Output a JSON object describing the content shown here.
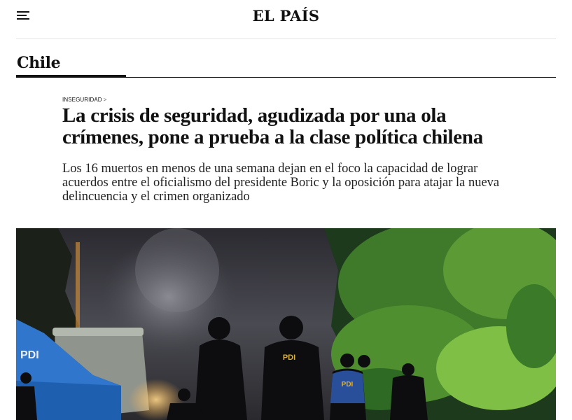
{
  "header": {
    "logo": "EL PAÍS",
    "menu_icon": "hamburger-menu-icon"
  },
  "section": {
    "title": "Chile"
  },
  "article": {
    "kicker": "Inseguridad",
    "kicker_separator": ">",
    "headline_line1": "La crisis de seguridad, agudizada por una ola",
    "headline_line2": "crímenes, pone a prueba a la clase política chilena",
    "dek_line1": "Los 16 muertos en menos de una semana dejan en el foco la capacidad de lograr",
    "dek_line2": "acuerdos entre el oficialismo del presidente Boric y la oposición para atajar la nueva",
    "dek_line3": "delincuencia y el crimen organizado"
  },
  "photo": {
    "tent_text": "PDI",
    "vest_text_1": "PDI",
    "vest_text_2": "PDI"
  },
  "colors": {
    "text": "#111111",
    "rule": "#e4e4e4",
    "tent_blue": "#1f5fb0"
  }
}
